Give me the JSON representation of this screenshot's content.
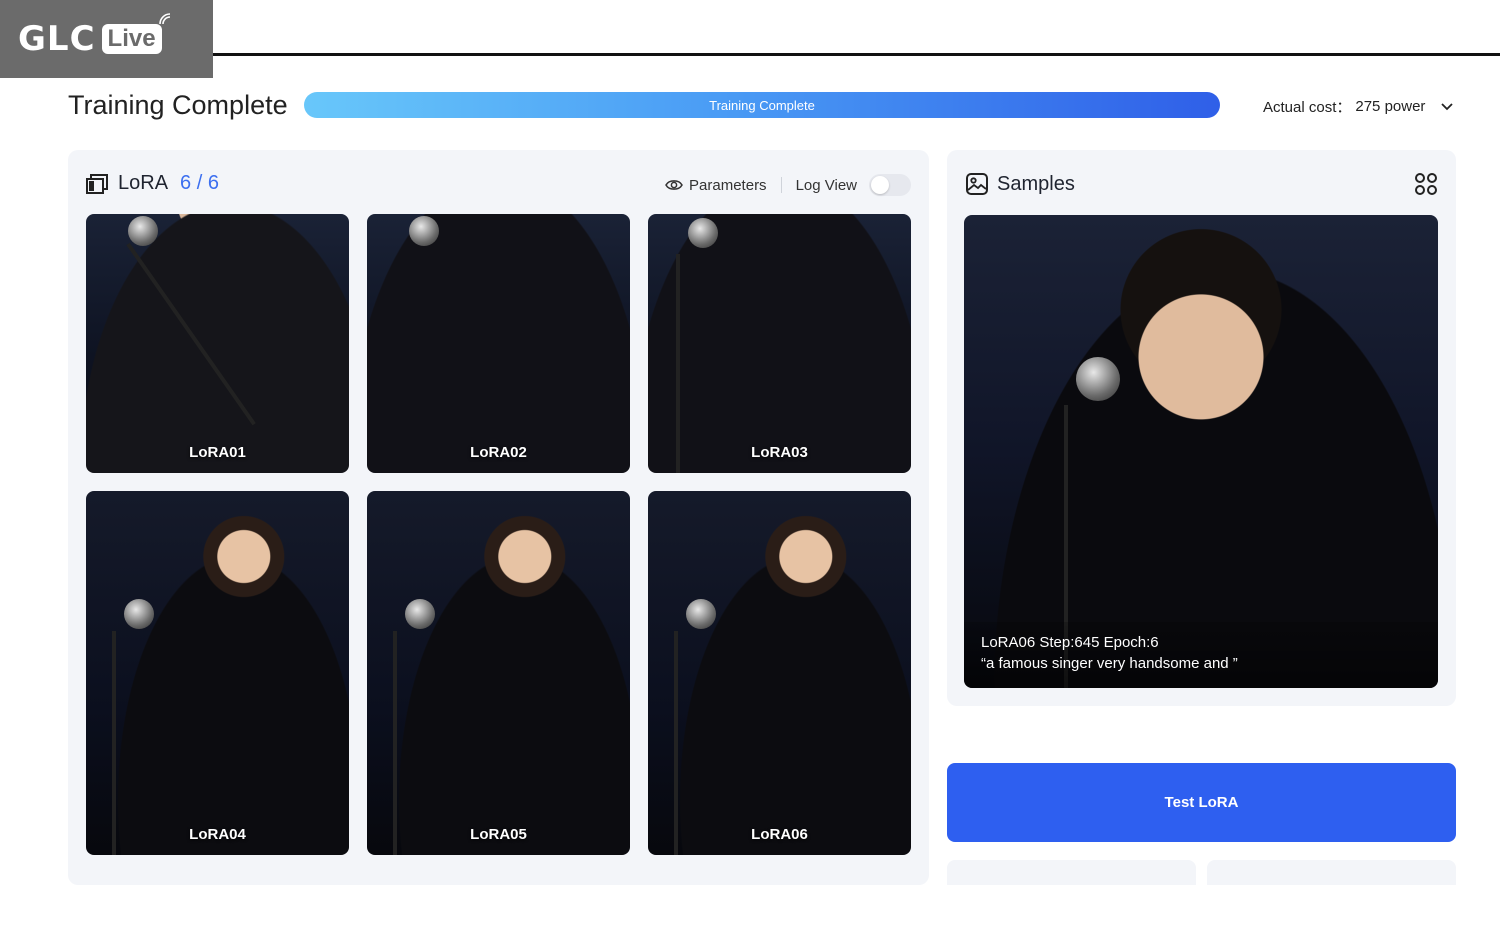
{
  "logo": {
    "brand": "GLC",
    "badge": "Live"
  },
  "header": {
    "title": "Training Complete",
    "progress_label": "Training Complete",
    "progress_percent": 100,
    "cost_label": "Actual cost：",
    "cost_value": "275 power"
  },
  "lora": {
    "title": "LoRA",
    "count": "6 / 6",
    "parameters_label": "Parameters",
    "log_view_label": "Log View",
    "log_view_on": false,
    "items": [
      {
        "label": "LoRA01"
      },
      {
        "label": "LoRA02"
      },
      {
        "label": "LoRA03"
      },
      {
        "label": "LoRA04"
      },
      {
        "label": "LoRA05"
      },
      {
        "label": "LoRA06"
      }
    ]
  },
  "samples": {
    "title": "Samples",
    "caption_line1": "LoRA06 Step:645 Epoch:6",
    "caption_line2": "“a famous singer very handsome and ”"
  },
  "actions": {
    "test_label": "Test LoRA"
  },
  "colors": {
    "accent": "#2e5ff0",
    "progress_start": "#68c7fa",
    "progress_end": "#2f5fe8"
  }
}
